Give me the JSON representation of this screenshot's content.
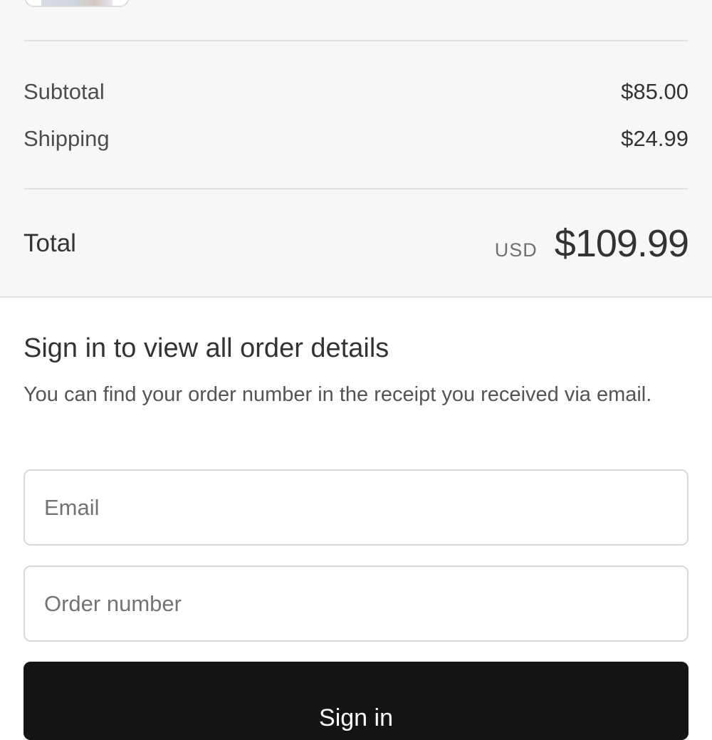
{
  "order_summary": {
    "subtotal_label": "Subtotal",
    "subtotal_value": "$85.00",
    "shipping_label": "Shipping",
    "shipping_value": "$24.99",
    "total_label": "Total",
    "total_currency": "USD",
    "total_value": "$109.99"
  },
  "signin": {
    "heading": "Sign in to view all order details",
    "description": "You can find your order number in the receipt you received via email.",
    "email_placeholder": "Email",
    "order_number_placeholder": "Order number",
    "button_label": "Sign in"
  },
  "colors": {
    "summary_background": "#f7f7f7",
    "button_background": "#141414",
    "text_primary": "#333333",
    "border": "#d9d9d9"
  }
}
